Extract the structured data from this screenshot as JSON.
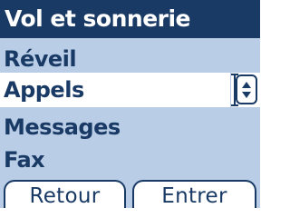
{
  "title": "Vol et sonnerie",
  "menu": {
    "items": [
      {
        "label": "Réveil",
        "selected": false
      },
      {
        "label": "Appels",
        "selected": true
      },
      {
        "label": "Messages",
        "selected": false
      },
      {
        "label": "Fax",
        "selected": false
      }
    ]
  },
  "scroll_indicator": {
    "icon": "up-down-arrows-icon"
  },
  "softkeys": {
    "left_label": "Retour",
    "right_label": "Entrer"
  },
  "colors": {
    "title_background": "#1a3a66",
    "title_text": "#ffffff",
    "list_background": "#b9cde6",
    "item_text": "#1a3a66",
    "highlight_background": "#ffffff",
    "softkey_background": "#ffffff"
  }
}
